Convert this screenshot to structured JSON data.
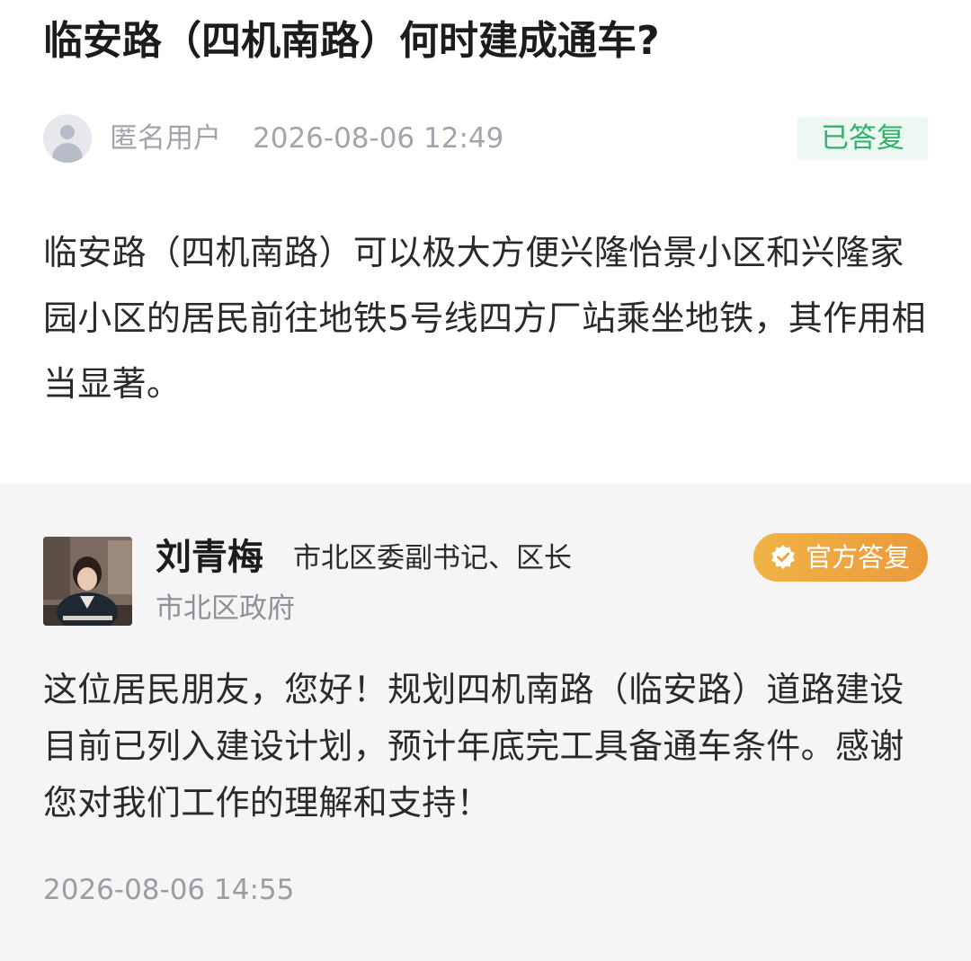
{
  "question": {
    "title": "临安路（四机南路）何时建成通车?",
    "asker": {
      "avatar_icon": "user-avatar-icon",
      "name": "匿名用户",
      "time": "2026-08-06 12:49"
    },
    "status": "已答复",
    "status_color": "#34b06c",
    "body": "临安路（四机南路）可以极大方便兴隆怡景小区和兴隆家园小区的居民前往地铁5号线四方厂站乘坐地铁，其作用相当显著。"
  },
  "reply": {
    "official": {
      "name": "刘青梅",
      "title": "市北区委副书记、区长",
      "organization": "市北区政府"
    },
    "badge": {
      "icon": "verified-check-icon",
      "label": "官方答复",
      "color": "#eea63f"
    },
    "body": "这位居民朋友，您好！规划四机南路（临安路）道路建设目前已列入建设计划，预计年底完工具备通车条件。感谢您对我们工作的理解和支持！",
    "time": "2026-08-06 14:55"
  },
  "colors": {
    "reply_background": "#f5f5f5",
    "text_primary": "#2a2a2a",
    "text_secondary": "#a2a5ab"
  }
}
